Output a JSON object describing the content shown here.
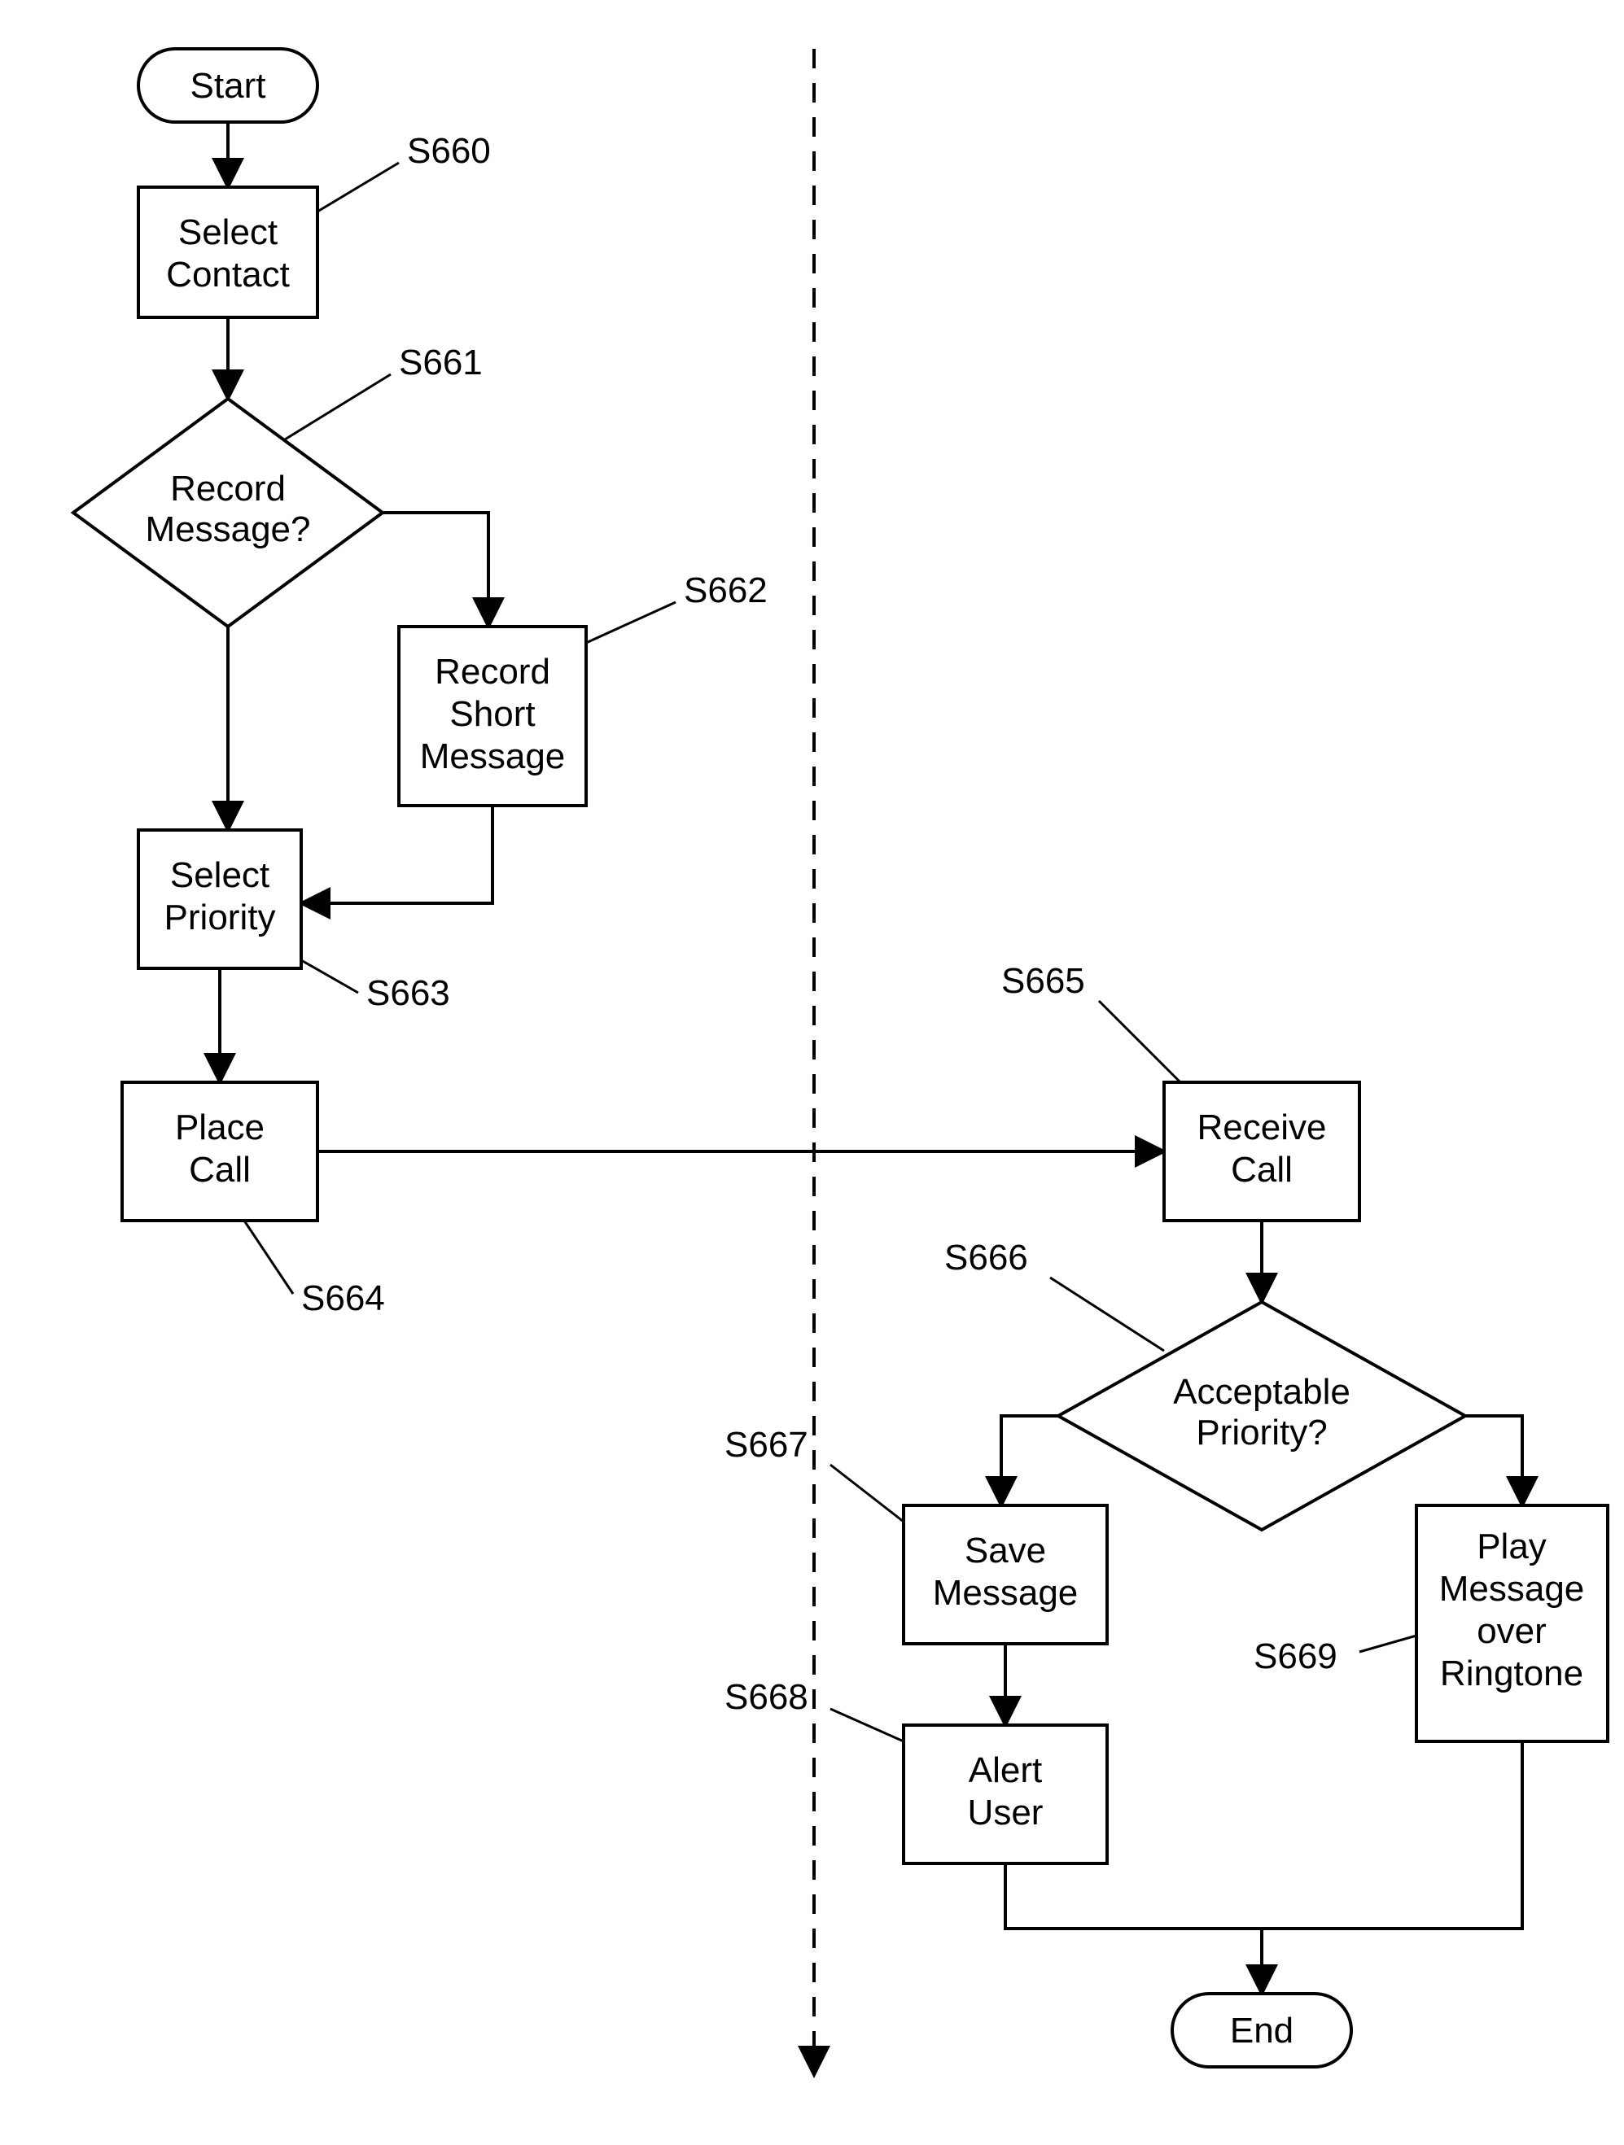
{
  "flowchart": {
    "start": "Start",
    "end": "End",
    "nodes": {
      "S660": {
        "label": "S660",
        "lines": [
          "Select",
          "Contact"
        ]
      },
      "S661": {
        "label": "S661",
        "lines": [
          "Record",
          "Message?"
        ]
      },
      "S662": {
        "label": "S662",
        "lines": [
          "Record",
          "Short",
          "Message"
        ]
      },
      "S663": {
        "label": "S663",
        "lines": [
          "Select",
          "Priority"
        ]
      },
      "S664": {
        "label": "S664",
        "lines": [
          "Place",
          "Call"
        ]
      },
      "S665": {
        "label": "S665",
        "lines": [
          "Receive",
          "Call"
        ]
      },
      "S666": {
        "label": "S666",
        "lines": [
          "Acceptable",
          "Priority?"
        ]
      },
      "S667": {
        "label": "S667",
        "lines": [
          "Save",
          "Message"
        ]
      },
      "S668": {
        "label": "S668",
        "lines": [
          "Alert",
          "User"
        ]
      },
      "S669": {
        "label": "S669",
        "lines": [
          "Play",
          "Message",
          "over",
          "Ringtone"
        ]
      }
    }
  }
}
